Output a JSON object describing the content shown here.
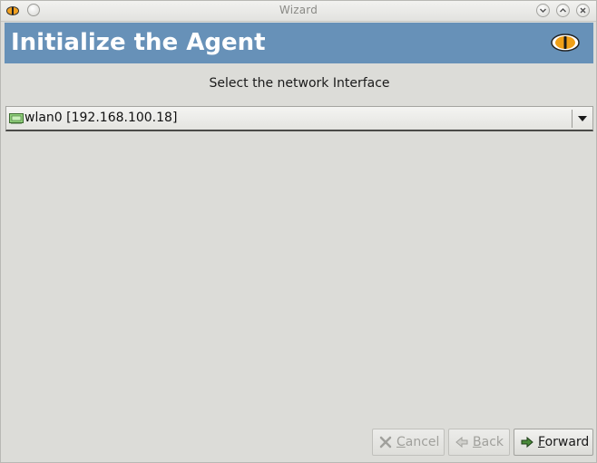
{
  "window": {
    "title": "Wizard"
  },
  "header": {
    "heading": "Initialize the Agent"
  },
  "prompt": {
    "text": "Select the network Interface"
  },
  "interface_select": {
    "selected_value": "wlan0 [192.168.100.18]",
    "icon": "network-icon"
  },
  "buttons": {
    "cancel": {
      "mnemonic": "C",
      "rest": "ancel",
      "enabled": false,
      "icon": "cancel-x-icon"
    },
    "back": {
      "mnemonic": "B",
      "rest": "ack",
      "enabled": false,
      "icon": "back-arrow-icon"
    },
    "forward": {
      "mnemonic": "F",
      "rest": "orward",
      "enabled": true,
      "icon": "forward-arrow-icon"
    }
  },
  "colors": {
    "header_bg": "#6791b8",
    "window_bg": "#dcdcd8"
  }
}
